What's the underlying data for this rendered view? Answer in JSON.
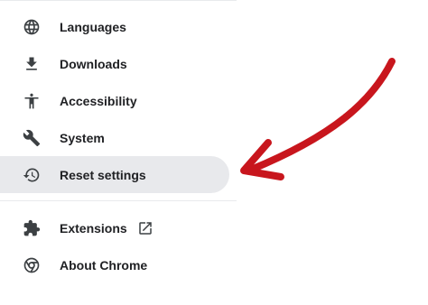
{
  "nav": {
    "items": [
      {
        "label": "Languages",
        "icon": "globe-icon"
      },
      {
        "label": "Downloads",
        "icon": "download-icon"
      },
      {
        "label": "Accessibility",
        "icon": "accessibility-icon"
      },
      {
        "label": "System",
        "icon": "wrench-icon"
      },
      {
        "label": "Reset settings",
        "icon": "history-icon",
        "active": true
      }
    ],
    "secondary": [
      {
        "label": "Extensions",
        "icon": "puzzle-icon",
        "external": "open-in-new-icon"
      },
      {
        "label": "About Chrome",
        "icon": "chrome-icon"
      }
    ]
  },
  "colors": {
    "text": "#202124",
    "icon": "#3c4043",
    "active_bg": "#e8e9ec",
    "arrow": "#c8161d"
  }
}
